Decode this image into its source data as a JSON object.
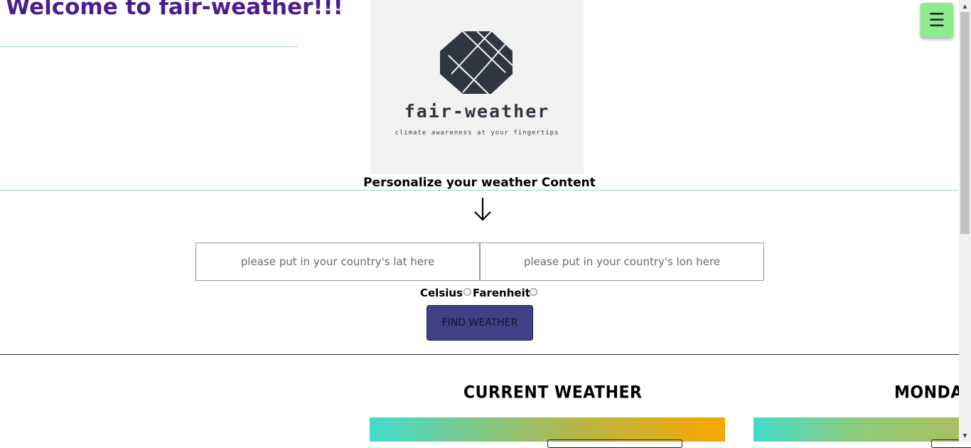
{
  "header": {
    "welcome": "Welcome to fair-weather!!!"
  },
  "logo": {
    "name": "fair-weather",
    "tagline": "climate awareness at your fingertips",
    "icon": "geodesic-octagon-icon"
  },
  "form": {
    "personalize_heading": "Personalize your weather Content",
    "arrow_icon": "arrow-down-icon",
    "lat_placeholder": "please put in your country's lat here",
    "lon_placeholder": "please put in your country's lon here",
    "unit_celsius": "Celsius",
    "unit_farenheit": "Farenheit",
    "submit_label": "FIND WEATHER"
  },
  "sections": {
    "current": "CURRENT WEATHER",
    "monday": "MONDAY"
  },
  "menu": {
    "icon": "hamburger-menu-icon",
    "glyph": "☰"
  },
  "colors": {
    "welcome_text": "#4b1e8f",
    "menu_button": "#8eeb8e",
    "submit_button": "#433f86",
    "card_gradient_start": "#42dccc",
    "card_gradient_end": "#f8a700"
  }
}
